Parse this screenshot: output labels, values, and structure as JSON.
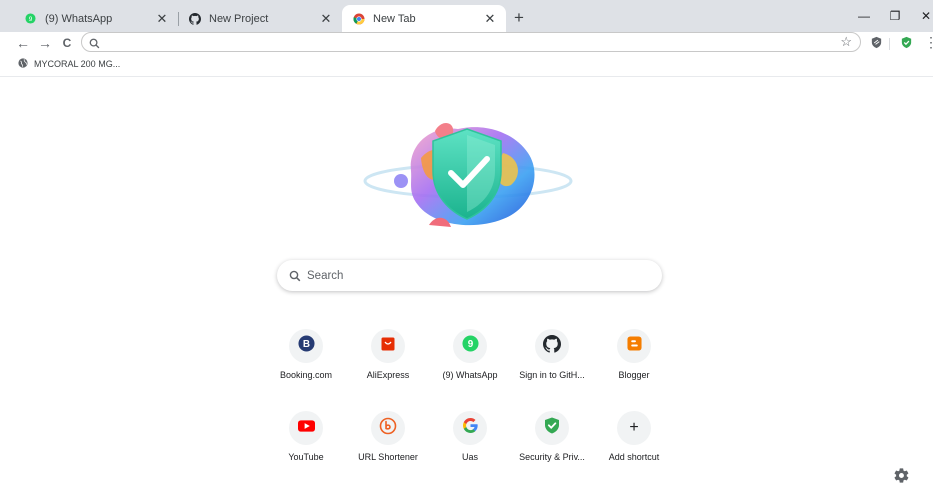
{
  "tabs": [
    {
      "label": "(9) WhatsApp",
      "icon": "whatsapp-icon",
      "active": false
    },
    {
      "label": "New Project",
      "icon": "github-icon",
      "active": false
    },
    {
      "label": "New Tab",
      "icon": "chrome-icon",
      "active": true
    }
  ],
  "tab_close_glyph": "✕",
  "window_controls": {
    "minimize": "—",
    "restore": "❐",
    "close": "✕"
  },
  "toolbar": {
    "back": "←",
    "forward": "→",
    "reload": "C",
    "bookmark_star": "☆",
    "menu": "⋮"
  },
  "omnibox": {
    "value": "",
    "placeholder": ""
  },
  "bookmarks": [
    {
      "label": "MYCORAL 200 MG...",
      "icon": "globe-icon"
    }
  ],
  "search": {
    "placeholder": "Search"
  },
  "shortcuts": [
    {
      "label": "Booking.com",
      "icon": "booking-icon"
    },
    {
      "label": "AliExpress",
      "icon": "aliexpress-icon"
    },
    {
      "label": "(9) WhatsApp",
      "icon": "whatsapp-icon"
    },
    {
      "label": "Sign in to GitH...",
      "icon": "github-icon"
    },
    {
      "label": "Blogger",
      "icon": "blogger-icon"
    },
    {
      "label": "YouTube",
      "icon": "youtube-icon"
    },
    {
      "label": "URL Shortener",
      "icon": "bitly-icon"
    },
    {
      "label": "Uas",
      "icon": "google-icon"
    },
    {
      "label": "Security & Priv...",
      "icon": "shield-icon"
    },
    {
      "label": "Add shortcut",
      "icon": "plus-icon"
    }
  ],
  "colors": {
    "tabstrip": "#dee1e6",
    "accent_green": "#34a853",
    "whatsapp": "#25d366"
  }
}
